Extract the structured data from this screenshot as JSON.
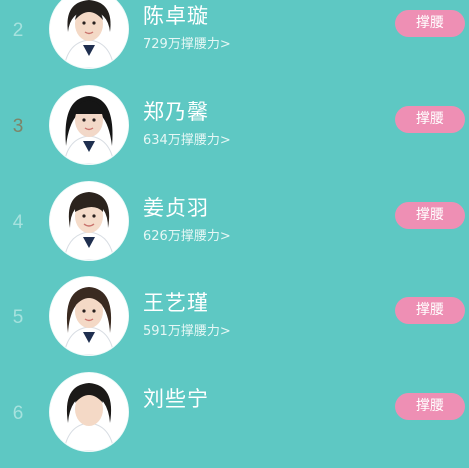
{
  "colors": {
    "background": "#5ec8c3",
    "button": "#ee8fb4",
    "rank_default": "#a6e2de",
    "rank_top3": "#7e8468"
  },
  "ranking": [
    {
      "rank": "2",
      "name": "陈卓璇",
      "score": "729万撑腰力>",
      "button": "撑腰",
      "avatar": "avatar-photo"
    },
    {
      "rank": "3",
      "name": "郑乃馨",
      "score": "634万撑腰力>",
      "button": "撑腰",
      "avatar": "avatar-photo"
    },
    {
      "rank": "4",
      "name": "姜贞羽",
      "score": "626万撑腰力>",
      "button": "撑腰",
      "avatar": "avatar-photo"
    },
    {
      "rank": "5",
      "name": "王艺瑾",
      "score": "591万撑腰力>",
      "button": "撑腰",
      "avatar": "avatar-photo"
    },
    {
      "rank": "6",
      "name": "刘些宁",
      "score": "",
      "button": "撑腰",
      "avatar": "avatar-photo"
    }
  ]
}
